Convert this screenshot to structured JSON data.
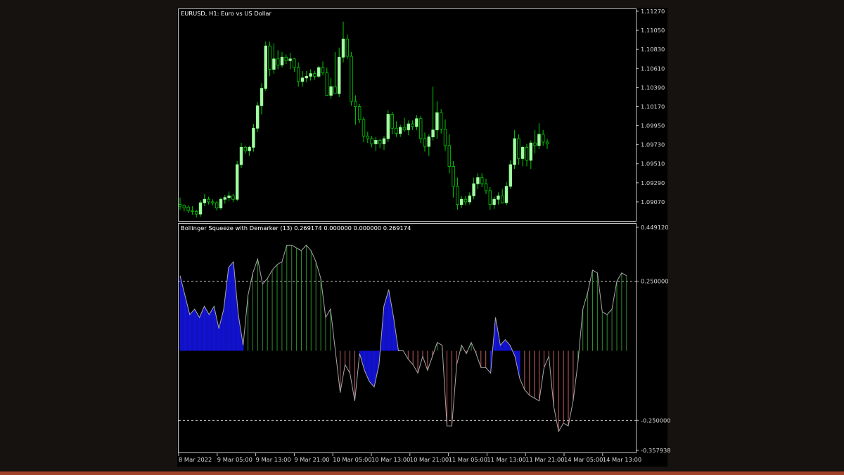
{
  "window": {
    "price_title": "EURUSD, H1:  Euro vs US Dollar",
    "indicator_title": "Bollinger Squeeze with Demarker (13) 0.269174 0.000000 0.000000 0.269174"
  },
  "colors": {
    "background": "#000000",
    "frame": "#c0c0c0",
    "bull_body": "#a0ffa0",
    "wick": "#00cc00",
    "bear_body": "#000000",
    "hist_green": "#2e8b2e",
    "hist_blue": "#1414e6",
    "hist_red": "#c46060",
    "signal_line": "#a8a8a8",
    "level_line": "#c8c8c8",
    "page_stripe": "#a0432a"
  },
  "price_axis": {
    "labels": [
      "1.11270",
      "1.11050",
      "1.10830",
      "1.10610",
      "1.10390",
      "1.10170",
      "1.09950",
      "1.09730",
      "1.09510",
      "1.09290",
      "1.09070"
    ]
  },
  "indicator_axis": {
    "labels": [
      "0.449120",
      "0.250000",
      "-0.250000",
      "-0.357938"
    ]
  },
  "time_axis": {
    "labels": [
      "8 Mar 2022",
      "9 Mar 05:00",
      "9 Mar 13:00",
      "9 Mar 21:00",
      "10 Mar 05:00",
      "10 Mar 13:00",
      "10 Mar 21:00",
      "11 Mar 05:00",
      "11 Mar 13:00",
      "11 Mar 21:00",
      "14 Mar 05:00",
      "14 Mar 13:00"
    ]
  },
  "chart_data": [
    {
      "type": "candlestick",
      "symbol": "EURUSD",
      "timeframe": "H1",
      "y_range": [
        1.0885,
        1.1127
      ],
      "candles": [
        [
          1.0904,
          1.0912,
          1.0898,
          1.0902
        ],
        [
          1.0903,
          1.0904,
          1.0896,
          1.09
        ],
        [
          1.0901,
          1.0903,
          1.0894,
          1.0897
        ],
        [
          1.0897,
          1.0902,
          1.0892,
          1.0896
        ],
        [
          1.0896,
          1.0898,
          1.0889,
          1.0893
        ],
        [
          1.0893,
          1.0909,
          1.089,
          1.0906
        ],
        [
          1.0906,
          1.0916,
          1.0902,
          1.091
        ],
        [
          1.091,
          1.0913,
          1.0904,
          1.0907
        ],
        [
          1.0907,
          1.091,
          1.0903,
          1.0906
        ],
        [
          1.0906,
          1.0908,
          1.0897,
          1.09
        ],
        [
          1.09,
          1.0912,
          1.0898,
          1.091
        ],
        [
          1.091,
          1.0915,
          1.0905,
          1.0912
        ],
        [
          1.0912,
          1.0919,
          1.0908,
          1.0914
        ],
        [
          1.0914,
          1.0916,
          1.0907,
          1.091
        ],
        [
          1.091,
          1.0954,
          1.0908,
          1.095
        ],
        [
          1.095,
          1.0975,
          1.0946,
          1.097
        ],
        [
          1.097,
          1.0972,
          1.0963,
          1.0966
        ],
        [
          1.0966,
          1.0972,
          1.096,
          1.097
        ],
        [
          1.097,
          1.0997,
          1.0965,
          1.0992
        ],
        [
          1.0992,
          1.1022,
          1.0988,
          1.1018
        ],
        [
          1.1018,
          1.1044,
          1.1008,
          1.1038
        ],
        [
          1.1038,
          1.1092,
          1.1035,
          1.1087
        ],
        [
          1.1087,
          1.1092,
          1.1052,
          1.106
        ],
        [
          1.106,
          1.109,
          1.1055,
          1.1072
        ],
        [
          1.1072,
          1.1082,
          1.106,
          1.1065
        ],
        [
          1.1065,
          1.108,
          1.1062,
          1.1074
        ],
        [
          1.1074,
          1.1077,
          1.1066,
          1.107
        ],
        [
          1.107,
          1.1079,
          1.106,
          1.1072
        ],
        [
          1.1072,
          1.1073,
          1.1057,
          1.1062
        ],
        [
          1.1062,
          1.1068,
          1.104,
          1.1046
        ],
        [
          1.1046,
          1.1058,
          1.104,
          1.105
        ],
        [
          1.105,
          1.1058,
          1.1045,
          1.1052
        ],
        [
          1.1052,
          1.106,
          1.1047,
          1.1055
        ],
        [
          1.1055,
          1.1058,
          1.1048,
          1.1052
        ],
        [
          1.1052,
          1.1064,
          1.105,
          1.1062
        ],
        [
          1.1062,
          1.1069,
          1.1053,
          1.1056
        ],
        [
          1.1056,
          1.1062,
          1.1038,
          1.103
        ],
        [
          1.103,
          1.105,
          1.1026,
          1.104
        ],
        [
          1.104,
          1.108,
          1.1036,
          1.1032
        ],
        [
          1.1032,
          1.1085,
          1.1028,
          1.1074
        ],
        [
          1.1074,
          1.1115,
          1.1068,
          1.1095
        ],
        [
          1.1095,
          1.11,
          1.1072,
          1.1075
        ],
        [
          1.1075,
          1.108,
          1.1018,
          1.1023
        ],
        [
          1.1023,
          1.103,
          1.0996,
          1.1017
        ],
        [
          1.1017,
          1.102,
          1.0998,
          1.1002
        ],
        [
          1.1002,
          1.1005,
          1.0976,
          1.0983
        ],
        [
          1.0983,
          1.0988,
          1.0975,
          1.098
        ],
        [
          1.098,
          1.0983,
          1.097,
          1.0974
        ],
        [
          1.0974,
          1.0982,
          1.0966,
          1.0978
        ],
        [
          1.0978,
          1.098,
          1.0969,
          1.0974
        ],
        [
          1.0974,
          1.0983,
          1.0967,
          1.098
        ],
        [
          1.098,
          1.1013,
          1.0976,
          1.1008
        ],
        [
          1.1008,
          1.1011,
          1.0985,
          1.0992
        ],
        [
          1.0992,
          1.1,
          1.0982,
          1.0986
        ],
        [
          1.0986,
          1.0996,
          1.0982,
          1.0993
        ],
        [
          1.0993,
          1.1004,
          1.0988,
          1.099
        ],
        [
          1.099,
          1.1001,
          1.0984,
          1.0997
        ],
        [
          1.0997,
          1.1001,
          1.099,
          1.0994
        ],
        [
          1.0994,
          1.1007,
          1.099,
          1.1003
        ],
        [
          1.1003,
          1.1006,
          1.0975,
          1.098
        ],
        [
          1.098,
          1.0987,
          1.0965,
          1.0971
        ],
        [
          1.0971,
          1.0985,
          1.096,
          1.0982
        ],
        [
          1.0982,
          1.104,
          1.0978,
          1.099
        ],
        [
          1.099,
          1.1023,
          1.098,
          1.101
        ],
        [
          1.101,
          1.1014,
          1.0986,
          1.0991
        ],
        [
          1.0991,
          1.1002,
          1.0966,
          1.0972
        ],
        [
          1.0972,
          1.0985,
          1.094,
          1.0948
        ],
        [
          1.0948,
          1.0954,
          1.0912,
          1.0925
        ],
        [
          1.0925,
          1.0935,
          1.0898,
          1.0904
        ],
        [
          1.0904,
          1.0914,
          1.09,
          1.091
        ],
        [
          1.091,
          1.0914,
          1.0903,
          1.0907
        ],
        [
          1.0907,
          1.0918,
          1.0904,
          1.0914
        ],
        [
          1.0914,
          1.0935,
          1.091,
          1.0928
        ],
        [
          1.0928,
          1.094,
          1.0922,
          1.0935
        ],
        [
          1.0935,
          1.094,
          1.0924,
          1.0928
        ],
        [
          1.0928,
          1.0934,
          1.0916,
          1.092
        ],
        [
          1.092,
          1.0924,
          1.0898,
          1.0904
        ],
        [
          1.0904,
          1.0913,
          1.0899,
          1.091
        ],
        [
          1.091,
          1.0918,
          1.0904,
          1.0914
        ],
        [
          1.0914,
          1.0922,
          1.0905,
          1.0906
        ],
        [
          1.0906,
          1.093,
          1.0903,
          1.0925
        ],
        [
          1.0925,
          1.0955,
          1.0922,
          1.095
        ],
        [
          1.095,
          1.099,
          1.0945,
          1.098
        ],
        [
          1.098,
          1.0985,
          1.095,
          1.0957
        ],
        [
          1.0957,
          1.0972,
          1.0948,
          1.097
        ],
        [
          1.097,
          1.0974,
          1.0948,
          1.0955
        ],
        [
          1.0955,
          1.0978,
          1.0945,
          1.0975
        ],
        [
          1.0975,
          1.099,
          1.0963,
          1.0972
        ],
        [
          1.0972,
          1.0998,
          1.0968,
          1.0985
        ],
        [
          1.0985,
          1.099,
          1.0972,
          1.0976
        ],
        [
          1.0976,
          1.098,
          1.0968,
          1.0974
        ]
      ]
    },
    {
      "type": "bar",
      "name": "Bollinger Squeeze with Demarker (13)",
      "y_range": [
        -0.357938,
        0.44912
      ],
      "levels": [
        0.25,
        -0.25
      ],
      "bars": [
        [
          0.27,
          "blue"
        ],
        [
          0.2,
          "blue"
        ],
        [
          0.13,
          "blue"
        ],
        [
          0.15,
          "blue"
        ],
        [
          0.12,
          "blue"
        ],
        [
          0.16,
          "blue"
        ],
        [
          0.13,
          "blue"
        ],
        [
          0.16,
          "blue"
        ],
        [
          0.08,
          "blue"
        ],
        [
          0.15,
          "blue"
        ],
        [
          0.3,
          "blue"
        ],
        [
          0.32,
          "blue"
        ],
        [
          0.13,
          "blue"
        ],
        [
          0.02,
          "blue"
        ],
        [
          0.2,
          "green"
        ],
        [
          0.28,
          "green"
        ],
        [
          0.33,
          "green"
        ],
        [
          0.24,
          "green"
        ],
        [
          0.26,
          "green"
        ],
        [
          0.29,
          "green"
        ],
        [
          0.31,
          "green"
        ],
        [
          0.32,
          "green"
        ],
        [
          0.38,
          "green"
        ],
        [
          0.38,
          "green"
        ],
        [
          0.37,
          "green"
        ],
        [
          0.36,
          "green"
        ],
        [
          0.38,
          "green"
        ],
        [
          0.36,
          "green"
        ],
        [
          0.32,
          "green"
        ],
        [
          0.26,
          "green"
        ],
        [
          0.12,
          "green"
        ],
        [
          0.15,
          "green"
        ],
        [
          0.0,
          "green"
        ],
        [
          -0.15,
          "red"
        ],
        [
          -0.05,
          "red"
        ],
        [
          -0.08,
          "red"
        ],
        [
          -0.18,
          "red"
        ],
        [
          -0.01,
          "blue"
        ],
        [
          -0.07,
          "blue"
        ],
        [
          -0.11,
          "blue"
        ],
        [
          -0.13,
          "blue"
        ],
        [
          -0.05,
          "blue"
        ],
        [
          0.16,
          "blue"
        ],
        [
          0.22,
          "blue"
        ],
        [
          0.12,
          "blue"
        ],
        [
          0.0,
          "blue"
        ],
        [
          0.0,
          "red"
        ],
        [
          -0.03,
          "red"
        ],
        [
          -0.05,
          "red"
        ],
        [
          -0.08,
          "red"
        ],
        [
          -0.02,
          "red"
        ],
        [
          -0.07,
          "red"
        ],
        [
          -0.02,
          "red"
        ],
        [
          0.03,
          "green"
        ],
        [
          0.02,
          "green"
        ],
        [
          -0.27,
          "red"
        ],
        [
          -0.27,
          "red"
        ],
        [
          -0.05,
          "red"
        ],
        [
          0.02,
          "green"
        ],
        [
          -0.01,
          "red"
        ],
        [
          0.03,
          "green"
        ],
        [
          -0.01,
          "red"
        ],
        [
          -0.06,
          "red"
        ],
        [
          -0.06,
          "red"
        ],
        [
          -0.08,
          "blue"
        ],
        [
          0.12,
          "blue"
        ],
        [
          0.02,
          "blue"
        ],
        [
          0.04,
          "blue"
        ],
        [
          0.02,
          "blue"
        ],
        [
          -0.02,
          "blue"
        ],
        [
          -0.1,
          "blue"
        ],
        [
          -0.14,
          "red"
        ],
        [
          -0.16,
          "red"
        ],
        [
          -0.17,
          "red"
        ],
        [
          -0.18,
          "red"
        ],
        [
          -0.06,
          "red"
        ],
        [
          -0.02,
          "red"
        ],
        [
          -0.2,
          "red"
        ],
        [
          -0.29,
          "red"
        ],
        [
          -0.26,
          "red"
        ],
        [
          -0.27,
          "red"
        ],
        [
          -0.18,
          "red"
        ],
        [
          -0.04,
          "green"
        ],
        [
          0.15,
          "green"
        ],
        [
          0.21,
          "green"
        ],
        [
          0.29,
          "green"
        ],
        [
          0.28,
          "green"
        ],
        [
          0.14,
          "green"
        ],
        [
          0.13,
          "green"
        ],
        [
          0.15,
          "green"
        ],
        [
          0.25,
          "green"
        ],
        [
          0.28,
          "green"
        ],
        [
          0.27,
          "green"
        ]
      ]
    }
  ]
}
